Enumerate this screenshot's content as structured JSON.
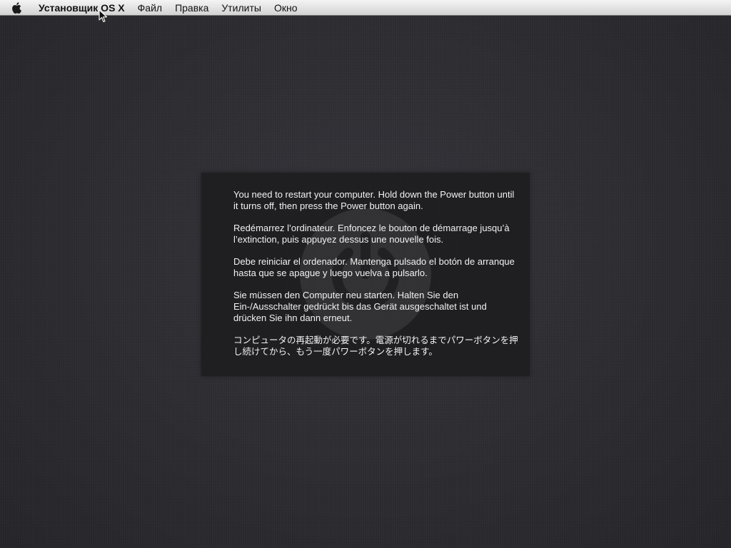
{
  "menubar": {
    "apple_icon": "apple-icon",
    "app_name": "Установщик OS X",
    "items": [
      "Файл",
      "Правка",
      "Утилиты",
      "Окно"
    ]
  },
  "panel": {
    "background_icon": "power-icon",
    "messages": {
      "en": "You need to restart your computer. Hold down the Power button until it turns off, then press the Power button again.",
      "fr": "Redémarrez l’ordinateur. Enfoncez le bouton de démarrage jusqu’à l’extinction, puis appuyez dessus une nouvelle fois.",
      "es": "Debe reiniciar el ordenador. Mantenga pulsado el botón de arranque hasta que se apague y luego vuelva a pulsarlo.",
      "de": "Sie müssen den Computer neu starten. Halten Sie den Ein-/Ausschalter gedrückt bis das Gerät ausgeschaltet ist und drücken Sie ihn dann erneut.",
      "ja": "コンピュータの再起動が必要です。電源が切れるまでパワーボタンを押し続けてから、もう一度パワーボタンを押します。"
    }
  },
  "colors": {
    "desktop_background": "#2e2e32",
    "panel_background": "#1e1e20",
    "panel_text": "#f2f2f2",
    "menubar": "#e4e4e4"
  }
}
